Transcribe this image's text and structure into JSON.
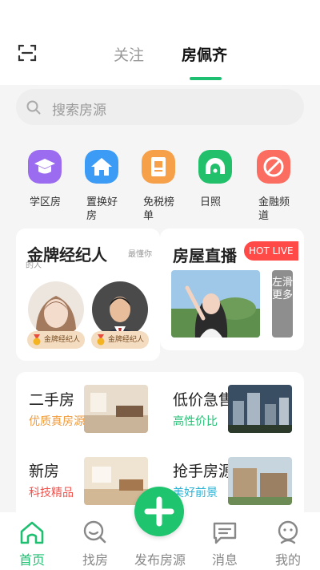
{
  "header": {
    "tabs": [
      {
        "label": "关注",
        "active": false
      },
      {
        "label": "房佩齐",
        "active": true
      }
    ],
    "accent_color": "#1fbf72"
  },
  "search": {
    "placeholder": "搜索房源"
  },
  "quick_links": [
    {
      "label": "学区房",
      "icon": "graduation-cap-icon",
      "color": "#9b6cf0"
    },
    {
      "label": "置换好房",
      "icon": "house-icon",
      "color": "#3c9cf5"
    },
    {
      "label": "免税榜单",
      "icon": "receipt-icon",
      "color": "#f7a04a"
    },
    {
      "label": "日照",
      "icon": "sun-arch-icon",
      "color": "#22c06a"
    },
    {
      "label": "金融频道",
      "icon": "finance-icon",
      "color": "#fb6d60"
    }
  ],
  "gold_agents": {
    "title": "金牌经纪人",
    "subtitle": "最懂你的人",
    "agents": [
      {
        "badge": "金牌经纪人"
      },
      {
        "badge": "金牌经纪人"
      }
    ]
  },
  "live": {
    "title": "房屋直播",
    "hot_label": "HOT LIVE",
    "slide_more": "左滑更多"
  },
  "categories": [
    {
      "title": "二手房",
      "subtitle": "优质真房源",
      "subtitle_color": "#f09a38"
    },
    {
      "title": "低价急售",
      "subtitle": "高性价比",
      "subtitle_color": "#1fbf72"
    },
    {
      "title": "新房",
      "subtitle": "科技精品",
      "subtitle_color": "#f2504a"
    },
    {
      "title": "抢手房源",
      "subtitle": "美好前景",
      "subtitle_color": "#2ab3d6"
    }
  ],
  "bottom_nav": {
    "items": [
      {
        "label": "首页",
        "icon": "home-icon",
        "active": true
      },
      {
        "label": "找房",
        "icon": "find-house-icon",
        "active": false
      },
      {
        "label": "发布房源",
        "icon": "plus-icon",
        "active": false
      },
      {
        "label": "消息",
        "icon": "message-icon",
        "active": false
      },
      {
        "label": "我的",
        "icon": "profile-icon",
        "active": false
      }
    ],
    "active_color": "#1fbf72",
    "inactive_color": "#888888"
  }
}
